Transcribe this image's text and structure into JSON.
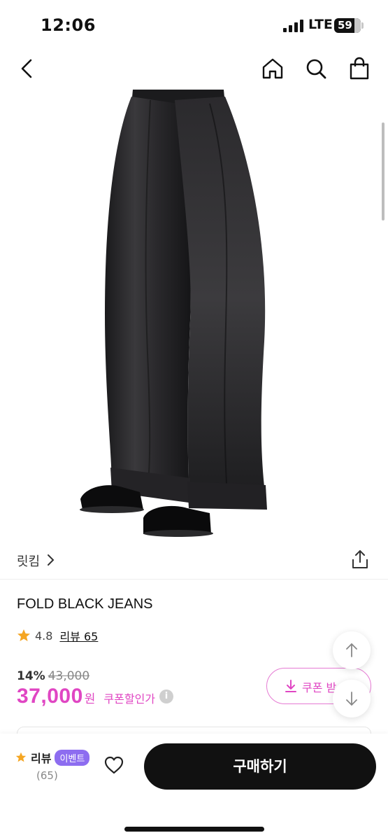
{
  "status_bar": {
    "time": "12:06",
    "network": "LTE",
    "battery": "59"
  },
  "nav": {
    "icons": [
      "back-icon",
      "home-icon",
      "search-icon",
      "shopping-bag-icon"
    ]
  },
  "product": {
    "image_icon": "black-wide-jeans-photo",
    "brand": "릿킴",
    "title": "FOLD BLACK JEANS",
    "rating": "4.8",
    "review_link": "리뷰 65",
    "discount_rate": "14%",
    "original_price": "43,000",
    "sale_price": "37,000",
    "currency": "원",
    "coupon_price_label": "쿠폰할인가",
    "info_symbol": "i"
  },
  "coupon_button": {
    "label": "쿠폰 받"
  },
  "bottom_bar": {
    "review_label": "리뷰",
    "event_badge": "이벤트",
    "review_count": "(65)",
    "buy_label": "구매하기"
  },
  "colors": {
    "accent": "#e046c3",
    "event_badge": "#8d6df0",
    "star": "#f5a623",
    "buy_button": "#111111"
  }
}
